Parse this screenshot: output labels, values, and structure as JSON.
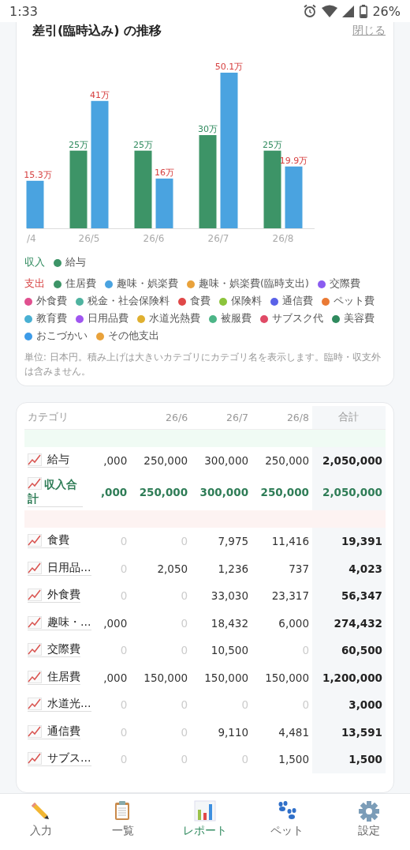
{
  "status_bar": {
    "time": "1:33",
    "battery": "26%"
  },
  "chart_card": {
    "title": "差引(臨時込み) の推移",
    "close": "閉じる",
    "chart_data": {
      "type": "bar",
      "categories": [
        "/4",
        "26/5",
        "26/6",
        "26/7",
        "26/8"
      ],
      "series": [
        {
          "name": "収入",
          "color": "#3d9467",
          "values": [
            null,
            25,
            25,
            30,
            25
          ],
          "value_labels": [
            null,
            "25万",
            "25万",
            "30万",
            "25万"
          ]
        },
        {
          "name": "支出",
          "color": "#4aa3e0",
          "values": [
            15.3,
            41,
            16,
            50.1,
            19.9
          ],
          "value_labels": [
            "15.3万",
            "41万",
            "16万",
            "50.1万",
            "19.9万"
          ]
        }
      ],
      "data_labels": true
    },
    "legend": [
      {
        "kind": "income",
        "items": [
          {
            "name": "給与",
            "color": "#3d9467"
          }
        ]
      },
      {
        "kind": "expense",
        "items": [
          {
            "name": "住居費",
            "color": "#3d9467"
          },
          {
            "name": "趣味・娯楽費",
            "color": "#4aa3e0"
          },
          {
            "name": "趣味・娯楽費(臨時支出)",
            "color": "#e9a23b"
          },
          {
            "name": "交際費",
            "color": "#8a5cf0"
          },
          {
            "name": "外食費",
            "color": "#e0508f"
          },
          {
            "name": "税金・社会保険料",
            "color": "#4fb3a0"
          },
          {
            "name": "食費",
            "color": "#e04848"
          },
          {
            "name": "保険料",
            "color": "#8cc43c"
          },
          {
            "name": "通信費",
            "color": "#5a62e8"
          },
          {
            "name": "ペット費",
            "color": "#ea7a35"
          },
          {
            "name": "教育費",
            "color": "#49b0d3"
          },
          {
            "name": "日用品費",
            "color": "#a056f0"
          },
          {
            "name": "水道光熱費",
            "color": "#e0b030"
          },
          {
            "name": "被服費",
            "color": "#4cb587"
          },
          {
            "name": "サブスク代",
            "color": "#e04a66"
          },
          {
            "name": "美容費",
            "color": "#2f8a5e"
          },
          {
            "name": "おこづかい",
            "color": "#3d9be8"
          },
          {
            "name": "その他支出",
            "color": "#e9a23b"
          }
        ]
      }
    ],
    "note": "単位: 日本円。積み上げは大きいカテゴリにカテゴリ名を表示します。臨時・収支外は含みません。"
  },
  "table": {
    "columns": [
      {
        "kind": "category",
        "label": "カテゴリ"
      },
      {
        "kind": "month"
      },
      {
        "kind": "month",
        "label": "26/6"
      },
      {
        "kind": "month",
        "label": "26/7"
      },
      {
        "kind": "month",
        "label": "26/8"
      },
      {
        "kind": "total",
        "label": "合計"
      }
    ],
    "rows": [
      {
        "kind": "income_section"
      },
      {
        "kind": "item",
        "name": "給与",
        "cells": [
          ",000",
          "250,000",
          "300,000",
          "250,000"
        ],
        "dim": [
          false,
          false,
          false,
          false
        ],
        "total": "2,050,000"
      },
      {
        "kind": "subtotal",
        "name": "収入合計",
        "cells": [
          ",000",
          "250,000",
          "300,000",
          "250,000"
        ],
        "total": "2,050,000"
      },
      {
        "kind": "expense_section"
      },
      {
        "kind": "item",
        "name": "食費",
        "cells": [
          "0",
          "0",
          "7,975",
          "11,416"
        ],
        "dim": [
          true,
          true,
          false,
          false
        ],
        "total": "19,391"
      },
      {
        "kind": "item",
        "name": "日用品…",
        "cells": [
          "0",
          "2,050",
          "1,236",
          "737"
        ],
        "dim": [
          true,
          false,
          false,
          false
        ],
        "total": "4,023"
      },
      {
        "kind": "item",
        "name": "外食費",
        "cells": [
          "0",
          "0",
          "33,030",
          "23,317"
        ],
        "dim": [
          true,
          true,
          false,
          false
        ],
        "total": "56,347"
      },
      {
        "kind": "item",
        "name": "趣味・…",
        "cells": [
          ",000",
          "0",
          "18,432",
          "6,000"
        ],
        "dim": [
          false,
          true,
          false,
          false
        ],
        "total": "274,432"
      },
      {
        "kind": "item",
        "name": "交際費",
        "cells": [
          "0",
          "0",
          "10,500",
          "0"
        ],
        "dim": [
          true,
          true,
          false,
          true
        ],
        "total": "60,500"
      },
      {
        "kind": "item",
        "name": "住居費",
        "cells": [
          ",000",
          "150,000",
          "150,000",
          "150,000"
        ],
        "dim": [
          false,
          false,
          false,
          false
        ],
        "total": "1,200,000"
      },
      {
        "kind": "item",
        "name": "水道光…",
        "cells": [
          "0",
          "0",
          "0",
          "0"
        ],
        "dim": [
          true,
          true,
          true,
          true
        ],
        "total": "3,000"
      },
      {
        "kind": "item",
        "name": "通信費",
        "cells": [
          "0",
          "0",
          "9,110",
          "4,481"
        ],
        "dim": [
          true,
          true,
          false,
          false
        ],
        "total": "13,591"
      },
      {
        "kind": "item",
        "name": "サブス…",
        "cells": [
          "0",
          "0",
          "0",
          "1,500"
        ],
        "dim": [
          true,
          true,
          true,
          false
        ],
        "total": "1,500"
      }
    ]
  },
  "nav": [
    {
      "kind": "pencil",
      "label": "入力",
      "selected": false
    },
    {
      "kind": "clipboard",
      "label": "一覧",
      "selected": false
    },
    {
      "kind": "chart",
      "label": "レポート",
      "selected": true
    },
    {
      "kind": "paw",
      "label": "ペット",
      "selected": false
    },
    {
      "kind": "gear",
      "label": "設定",
      "selected": false
    }
  ]
}
